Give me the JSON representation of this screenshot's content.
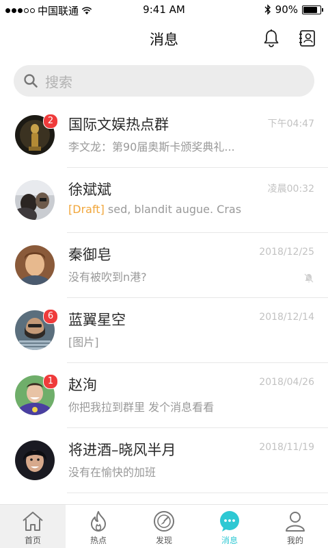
{
  "status_bar": {
    "carrier": "中国联通",
    "time": "9:41 AM",
    "battery": "90%",
    "battery_level": 0.9
  },
  "nav": {
    "title": "消息",
    "left_icon": "bell-icon",
    "right_icon": "contacts-icon"
  },
  "search": {
    "placeholder": "搜索"
  },
  "conversations": [
    {
      "name": "国际文娱热点群",
      "time": "下午04:47",
      "preview": "李文龙：第90届奥斯卡颁奖典礼...",
      "badge": "2",
      "draft_label": "",
      "muted": false
    },
    {
      "name": "徐斌斌",
      "time": "凌晨00:32",
      "preview": "sed, blandit augue. Cras",
      "badge": "",
      "draft_label": "[Draft]",
      "muted": false
    },
    {
      "name": "秦御皂",
      "time": "2018/12/25",
      "preview": "没有被吹到n港?",
      "badge": "",
      "draft_label": "",
      "muted": true
    },
    {
      "name": "蓝翼星空",
      "time": "2018/12/14",
      "preview": "[图片]",
      "badge": "6",
      "draft_label": "",
      "muted": false
    },
    {
      "name": "赵洵",
      "time": "2018/04/26",
      "preview": "你把我拉到群里 发个消息看看",
      "badge": "1",
      "draft_label": "",
      "muted": false
    },
    {
      "name": "将进酒–晓风半月",
      "time": "2018/11/19",
      "preview": "没有在愉快的加班",
      "badge": "",
      "draft_label": "",
      "muted": false
    }
  ],
  "tabs": [
    {
      "label": "首页",
      "icon": "home-icon",
      "active": false
    },
    {
      "label": "热点",
      "icon": "flame-icon",
      "active": false
    },
    {
      "label": "发现",
      "icon": "compass-icon",
      "active": false
    },
    {
      "label": "消息",
      "icon": "chat-bubble-icon",
      "active": true
    },
    {
      "label": "我的",
      "icon": "user-icon",
      "active": false
    }
  ],
  "colors": {
    "accent": "#2ec8d3",
    "badge": "#ef3b3b",
    "draft": "#f1a63a"
  }
}
